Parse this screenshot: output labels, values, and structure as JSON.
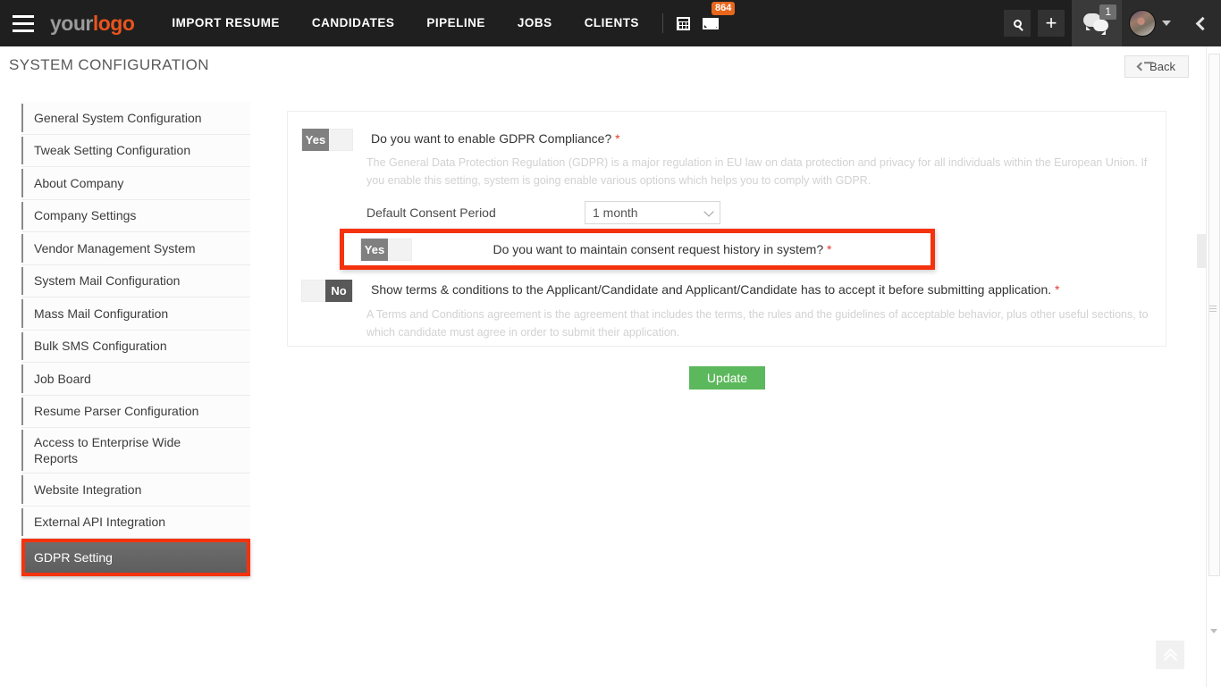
{
  "topnav": {
    "menu_icon": "hamburger-icon",
    "logo_part1": "your",
    "logo_part2": "logo",
    "links": [
      {
        "label": "IMPORT RESUME"
      },
      {
        "label": "CANDIDATES"
      },
      {
        "label": "PIPELINE"
      },
      {
        "label": "JOBS"
      },
      {
        "label": "CLIENTS"
      }
    ],
    "calendar_icon": "calendar-icon",
    "mail_icon": "mail-icon",
    "mail_badge": "864",
    "search_icon": "search-icon",
    "add_icon": "plus-icon",
    "chat_icon": "chat-icon",
    "chat_badge": "1",
    "avatar_icon": "avatar",
    "avatar_caret": "chevron-down-icon",
    "collapse_icon": "chevron-left-icon"
  },
  "page": {
    "title": "SYSTEM CONFIGURATION",
    "back_label": "Back",
    "back_icon": "arrow-left-icon"
  },
  "sidebar": {
    "items": [
      {
        "label": "General System Configuration",
        "active": false
      },
      {
        "label": "Tweak Setting Configuration",
        "active": false
      },
      {
        "label": "About Company",
        "active": false
      },
      {
        "label": "Company Settings",
        "active": false
      },
      {
        "label": "Vendor Management System",
        "active": false
      },
      {
        "label": "System Mail Configuration",
        "active": false
      },
      {
        "label": "Mass Mail Configuration",
        "active": false
      },
      {
        "label": "Bulk SMS Configuration",
        "active": false
      },
      {
        "label": "Job Board",
        "active": false
      },
      {
        "label": "Resume Parser Configuration",
        "active": false
      },
      {
        "label": "Access to Enterprise Wide Reports",
        "active": false
      },
      {
        "label": "Website Integration",
        "active": false
      },
      {
        "label": "External API Integration",
        "active": false
      },
      {
        "label": "GDPR Setting",
        "active": true
      }
    ],
    "highlight_color": "#f4330e"
  },
  "card": {
    "gdpr": {
      "toggle_value": "Yes",
      "question": "Do you want to enable GDPR Compliance?",
      "required_mark": "*",
      "description": "The General Data Protection Regulation (GDPR) is a major regulation in EU law on data protection and privacy for all individuals within the European Union. If you enable this setting, system is going enable various options which helps you to comply with GDPR."
    },
    "consent_period": {
      "label": "Default Consent Period",
      "selected": "1 month",
      "dropdown_icon": "chevron-down-icon"
    },
    "consent_history": {
      "toggle_value": "Yes",
      "question": "Do you want to maintain consent request history in system?",
      "required_mark": "*",
      "highlighted": true
    },
    "terms": {
      "toggle_value": "No",
      "question": "Show terms & conditions to the Applicant/Candidate and Applicant/Candidate has to accept it before submitting application.",
      "required_mark": "*",
      "description": "A Terms and Conditions agreement is the agreement that includes the terms, the rules and the guidelines of acceptable behavior, plus other useful sections, to which candidate must agree in order to submit their application."
    }
  },
  "actions": {
    "update_label": "Update",
    "update_color": "#5cb85c"
  },
  "misc": {
    "scroll_top_icon": "chevron-double-up-icon"
  }
}
